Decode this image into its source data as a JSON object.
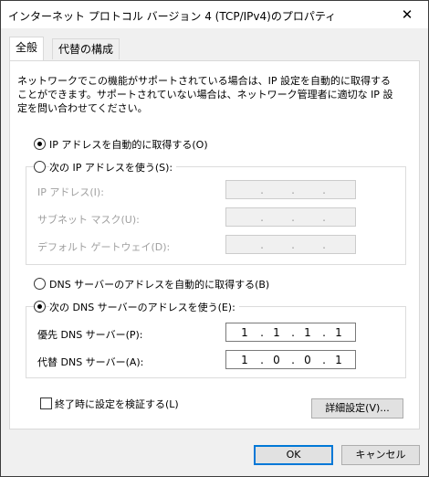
{
  "window": {
    "title": "インターネット プロトコル バージョン 4 (TCP/IPv4)のプロパティ",
    "close_glyph": "✕"
  },
  "tabs": [
    {
      "label": "全般"
    },
    {
      "label": "代替の構成"
    }
  ],
  "description": "ネットワークでこの機能がサポートされている場合は、IP 設定を自動的に取得することができます。サポートされていない場合は、ネットワーク管理者に適切な IP 設定を問い合わせてください。",
  "ip_section": {
    "auto_label": "IP アドレスを自動的に取得する(O)",
    "manual_label": "次の IP アドレスを使う(S):",
    "ip_address_label": "IP アドレス(I):",
    "subnet_label": "サブネット マスク(U):",
    "gateway_label": "デフォルト ゲートウェイ(D):",
    "selected": "auto"
  },
  "dns_section": {
    "auto_label": "DNS サーバーのアドレスを自動的に取得する(B)",
    "manual_label": "次の DNS サーバーのアドレスを使う(E):",
    "preferred_label": "優先 DNS サーバー(P):",
    "alternate_label": "代替 DNS サーバー(A):",
    "preferred": [
      "1",
      "1",
      "1",
      "1"
    ],
    "alternate": [
      "1",
      "0",
      "0",
      "1"
    ],
    "selected": "manual"
  },
  "validate_checkbox": {
    "label": "終了時に設定を検証する(L)",
    "checked": false
  },
  "buttons": {
    "advanced": "詳細設定(V)...",
    "ok": "OK",
    "cancel": "キャンセル"
  },
  "dot": "."
}
